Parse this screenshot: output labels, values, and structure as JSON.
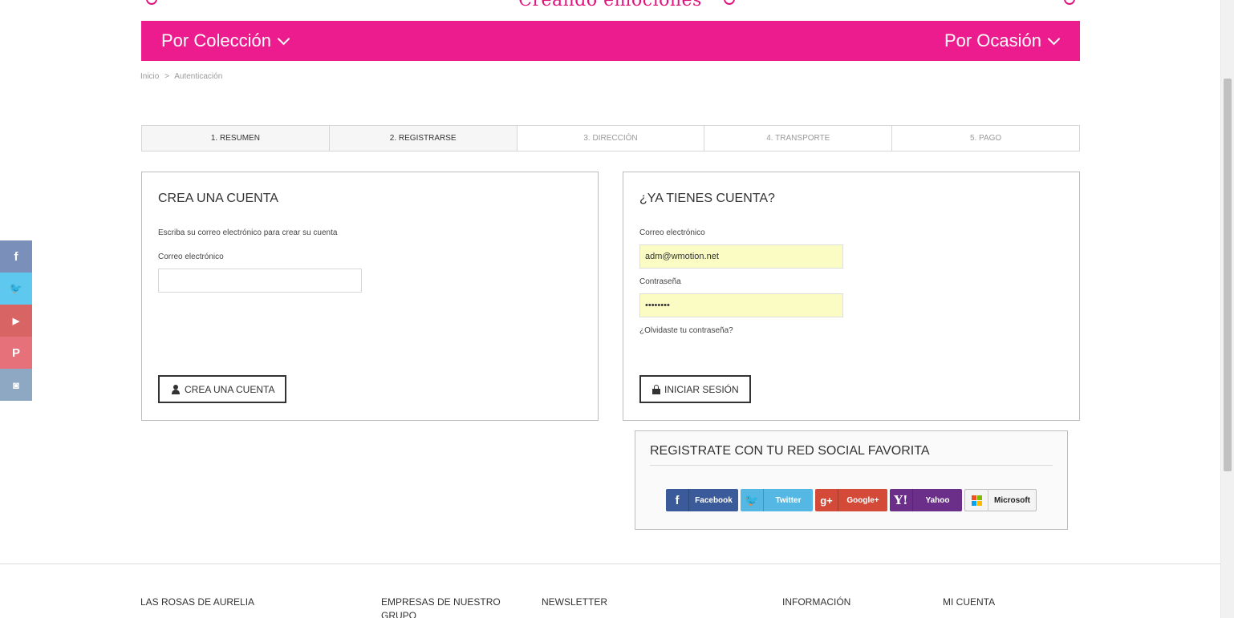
{
  "header": {
    "tagline": "Creando emociones",
    "nav_left": "Por Colección",
    "nav_right": "Por Ocasión"
  },
  "breadcrumb": {
    "home": "Inicio",
    "separator": ">",
    "current": "Autenticación"
  },
  "steps": [
    {
      "label": "1. RESUMEN"
    },
    {
      "label": "2. REGISTRARSE"
    },
    {
      "label": "3. DIRECCIÓN"
    },
    {
      "label": "4. TRANSPORTE"
    },
    {
      "label": "5. PAGO"
    }
  ],
  "create_account": {
    "title": "CREA UNA CUENTA",
    "instruction": "Escriba su correo electrónico para crear su cuenta",
    "email_label": "Correo electrónico",
    "email_value": "",
    "button_label": "CREA UNA CUENTA"
  },
  "login": {
    "title": "¿YA TIENES CUENTA?",
    "email_label": "Correo electrónico",
    "email_value": "adm@wmotion.net",
    "password_label": "Contraseña",
    "password_value": "••••••••",
    "forgot_label": "¿Olvidaste tu contraseña?",
    "button_label": "INICIAR SESIÓN"
  },
  "social_login": {
    "title": "REGISTRATE CON TU RED SOCIAL FAVORITA",
    "buttons": [
      {
        "label": "Facebook",
        "icon": "facebook-icon",
        "color": "#3b5a99"
      },
      {
        "label": "Twitter",
        "icon": "twitter-icon",
        "color": "#55b7e4"
      },
      {
        "label": "Google+",
        "icon": "google-plus-icon",
        "color": "#d34a38"
      },
      {
        "label": "Yahoo",
        "icon": "yahoo-icon",
        "color": "#6b2f8a"
      },
      {
        "label": "Microsoft",
        "icon": "microsoft-icon",
        "color": "#f4f4f4"
      }
    ]
  },
  "side_social": [
    {
      "icon": "facebook-icon",
      "glyph": "f"
    },
    {
      "icon": "twitter-icon",
      "glyph": "🐦"
    },
    {
      "icon": "youtube-icon",
      "glyph": "▶"
    },
    {
      "icon": "pinterest-icon",
      "glyph": "P"
    },
    {
      "icon": "instagram-icon",
      "glyph": "◙"
    }
  ],
  "footer": {
    "columns": [
      {
        "title": "LAS ROSAS DE AURELIA"
      },
      {
        "title": "EMPRESAS DE NUESTRO GRUPO"
      },
      {
        "title": "NEWSLETTER"
      },
      {
        "title": "INFORMACIÓN"
      },
      {
        "title": "MI CUENTA"
      }
    ]
  },
  "colors": {
    "brand_pink": "#ec1c8f",
    "autofill_yellow": "#fbfcc4"
  }
}
